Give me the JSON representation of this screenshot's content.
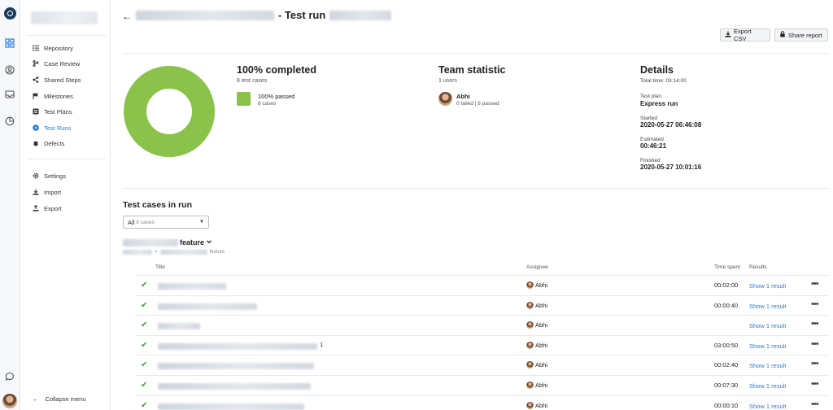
{
  "header": {
    "title_suffix": "- Test run",
    "export_csv_label": "Export CSV",
    "share_report_label": "Share report"
  },
  "sidebar": {
    "items": [
      {
        "label": "Repository",
        "icon": "repository-icon"
      },
      {
        "label": "Case Review",
        "icon": "branch-icon"
      },
      {
        "label": "Shared Steps",
        "icon": "share-icon"
      },
      {
        "label": "Milestones",
        "icon": "flag-icon"
      },
      {
        "label": "Test Plans",
        "icon": "list-icon"
      },
      {
        "label": "Test Runs",
        "icon": "play-circle-icon",
        "active": true
      },
      {
        "label": "Defects",
        "icon": "bug-icon"
      }
    ],
    "settings_items": [
      {
        "label": "Settings",
        "icon": "gear-icon"
      },
      {
        "label": "Import",
        "icon": "import-icon"
      },
      {
        "label": "Export",
        "icon": "export-icon"
      }
    ],
    "collapse_label": "Collapse menu"
  },
  "summary": {
    "completed_title": "100% completed",
    "completed_sub": "8 test cases",
    "legend_label": "100% passed",
    "legend_count": "8 cases",
    "passed_fraction": 1.0,
    "passed_color": "#8bc34a"
  },
  "team": {
    "title": "Team statistic",
    "sub": "1 users",
    "member_name": "Abhi",
    "member_stats": "0 failed | 8 passed"
  },
  "details": {
    "title": "Details",
    "total_time": "Total time: 03:14:00",
    "test_plan_label": "Test plan",
    "test_plan_value": "Express run",
    "started_label": "Started",
    "started_value": "2020-05-27 06:46:08",
    "estimated_label": "Estimated",
    "estimated_value": "00:46:21",
    "finished_label": "Finished",
    "finished_value": "2020-05-27 10:01:16"
  },
  "cases": {
    "section_title": "Test cases in run",
    "filter_value": "All",
    "filter_count": "8 cases",
    "suite_name": "feature",
    "crumb_sep": ">",
    "crumb_tail": "feature",
    "columns": {
      "title": "Title",
      "assignee": "Assignee",
      "time_spent": "Time spent",
      "results": "Results"
    },
    "rows": [
      {
        "suffix": "",
        "assignee": "Abhi",
        "time": "00:02:00",
        "result": "Show 1 result"
      },
      {
        "suffix": "",
        "assignee": "Abhi",
        "time": "00:00:40",
        "result": "Show 1 result"
      },
      {
        "suffix": "",
        "assignee": "Abhi",
        "time": "",
        "result": "Show 1 result"
      },
      {
        "suffix": "1",
        "assignee": "Abhi",
        "time": "03:00:50",
        "result": "Show 1 result"
      },
      {
        "suffix": "",
        "assignee": "Abhi",
        "time": "00:02:40",
        "result": "Show 1 result"
      },
      {
        "suffix": "",
        "assignee": "Abhi",
        "time": "00:07:30",
        "result": "Show 1 result"
      },
      {
        "suffix": "",
        "assignee": "Abhi",
        "time": "00:00:10",
        "result": "Show 1 result"
      }
    ]
  }
}
